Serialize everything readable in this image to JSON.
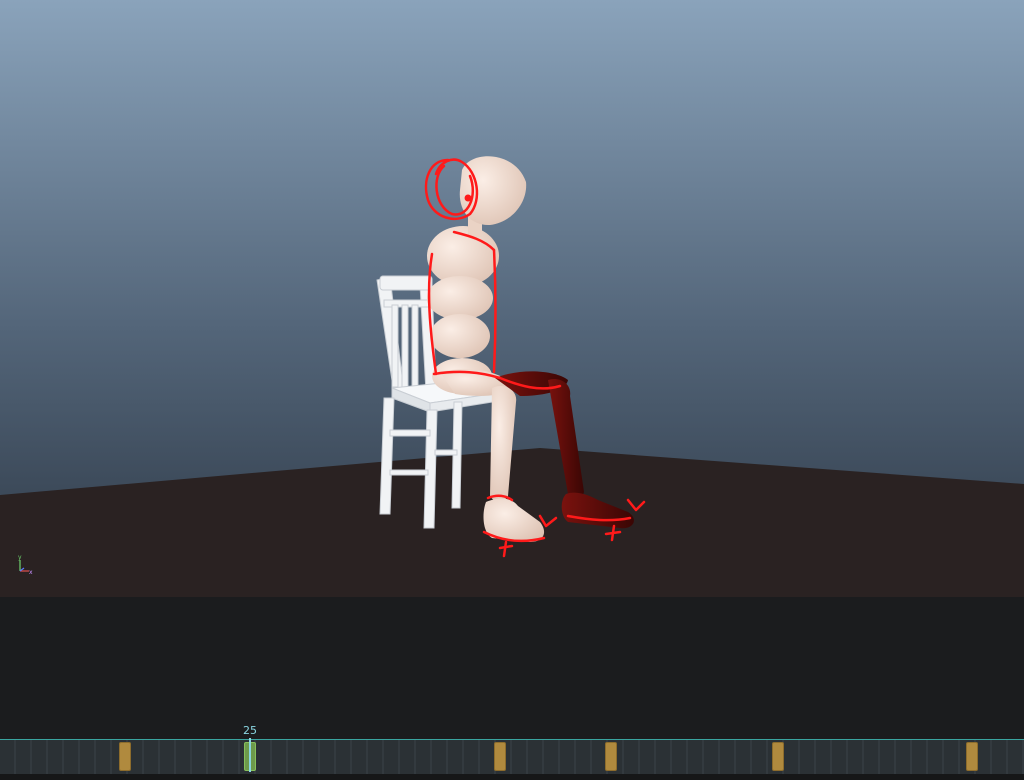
{
  "viewport": {
    "axis_labels": {
      "y": "y",
      "x": "x"
    }
  },
  "timeline": {
    "current_frame": "25",
    "current_frame_number": 25,
    "keyframe_positions_px": "",
    "keys": [
      {
        "id": "key-1",
        "current": false
      },
      {
        "id": "key-2",
        "current": true
      },
      {
        "id": "key-3",
        "current": false
      },
      {
        "id": "key-4",
        "current": false
      },
      {
        "id": "key-5",
        "current": false
      },
      {
        "id": "key-6",
        "current": false
      }
    ]
  },
  "colors": {
    "sky_top": "#8aa2ba",
    "sky_bottom": "#2f3b49",
    "floor": "#2a2222",
    "mannequin": "#f2ddd0",
    "selected_leg": "#6a0d0a",
    "sketch": "#ff1a1a",
    "timeline_accent": "#8ad6e2",
    "key": "#b08a3e"
  }
}
